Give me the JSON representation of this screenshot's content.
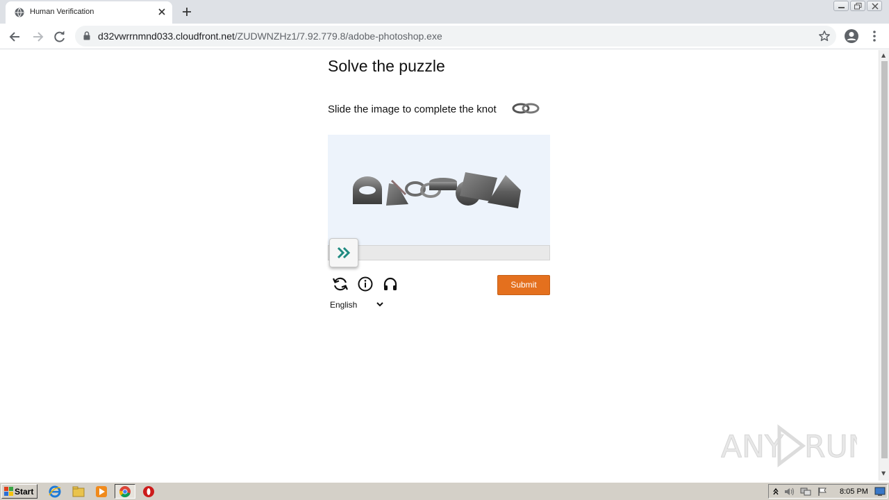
{
  "browser": {
    "tab_title": "Human Verification",
    "url_host": "d32vwrrnmnd033.cloudfront.net",
    "url_path": "/ZUDWNZHz1/7.92.779.8/adobe-photoshop.exe"
  },
  "page": {
    "title": "Solve the puzzle",
    "instruction": "Slide the image to complete the knot",
    "submit_label": "Submit",
    "language": "English"
  },
  "watermark": "ANY RUN",
  "taskbar": {
    "start_label": "Start",
    "clock": "8:05 PM"
  },
  "colors": {
    "accent": "#e4701e",
    "slider_arrow": "#1f8a80",
    "puzzle_bg": "#edf3fb"
  }
}
